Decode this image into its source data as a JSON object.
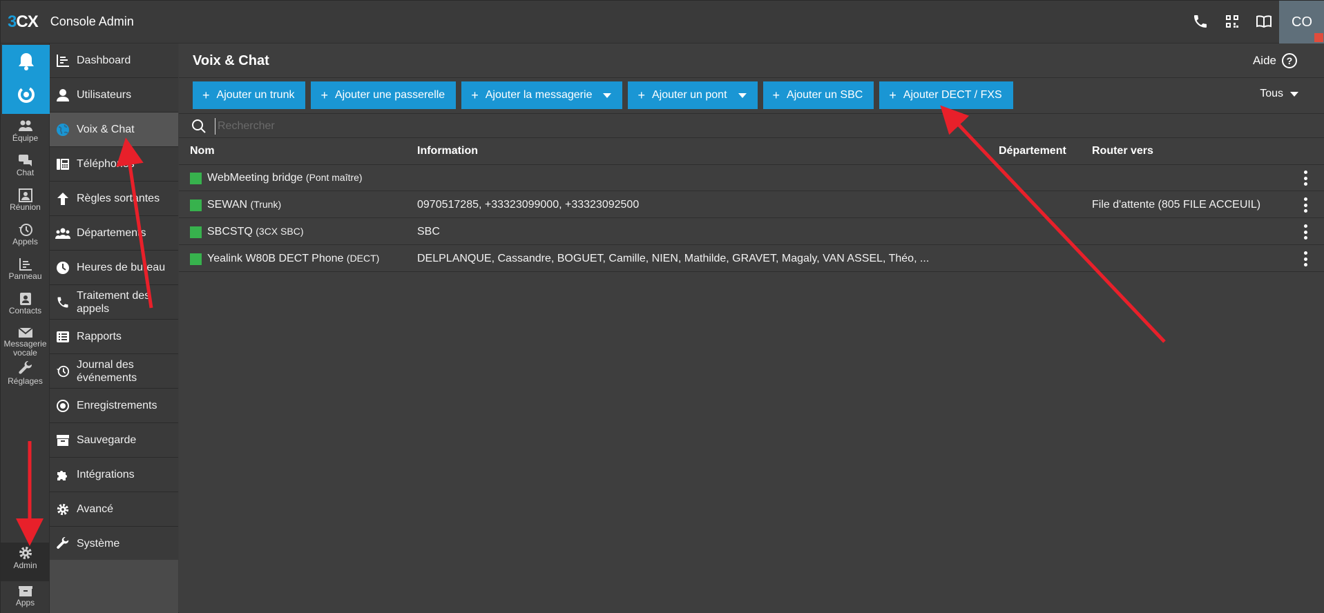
{
  "app": {
    "logo_prefix": "3",
    "logo_suffix": "CX",
    "title": "Console Admin",
    "avatar_initials": "CO"
  },
  "rail": {
    "items": [
      {
        "label": "Équipe",
        "icon": "team-icon"
      },
      {
        "label": "Chat",
        "icon": "chat-icon"
      },
      {
        "label": "Réunion",
        "icon": "meeting-icon"
      },
      {
        "label": "Appels",
        "icon": "history-icon"
      },
      {
        "label": "Panneau",
        "icon": "panel-icon"
      },
      {
        "label": "Contacts",
        "icon": "contacts-icon"
      },
      {
        "label": "Messagerie",
        "label2": "vocale",
        "icon": "voicemail-icon"
      },
      {
        "label": "Réglages",
        "icon": "wrench-icon"
      },
      {
        "label": "Admin",
        "icon": "gear-icon"
      },
      {
        "label": "Apps",
        "icon": "apps-icon"
      }
    ]
  },
  "submenu": {
    "items": [
      {
        "label": "Dashboard",
        "icon": "dashboard-icon"
      },
      {
        "label": "Utilisateurs",
        "icon": "user-icon"
      },
      {
        "label": "Voix & Chat",
        "icon": "globe-icon",
        "active": true
      },
      {
        "label": "Téléphones",
        "icon": "phone-device-icon"
      },
      {
        "label": "Règles sortantes",
        "icon": "arrow-up-icon"
      },
      {
        "label": "Départements",
        "icon": "departments-icon"
      },
      {
        "label": "Heures de bureau",
        "icon": "clock-icon"
      },
      {
        "label": "Traitement des",
        "label2": "appels",
        "icon": "phone-icon"
      },
      {
        "label": "Rapports",
        "icon": "report-icon"
      },
      {
        "label": "Journal des",
        "label2": "événements",
        "icon": "history-icon"
      },
      {
        "label": "Enregistrements",
        "icon": "record-icon"
      },
      {
        "label": "Sauvegarde",
        "icon": "archive-icon"
      },
      {
        "label": "Intégrations",
        "icon": "puzzle-icon"
      },
      {
        "label": "Avancé",
        "icon": "gear-icon"
      },
      {
        "label": "Système",
        "icon": "wrench-icon"
      }
    ]
  },
  "main": {
    "page_title": "Voix & Chat",
    "help_label": "Aide",
    "buttons": [
      {
        "label": "Ajouter un trunk",
        "dropdown": false
      },
      {
        "label": "Ajouter une passerelle",
        "dropdown": false
      },
      {
        "label": "Ajouter la messagerie",
        "dropdown": true
      },
      {
        "label": "Ajouter un pont",
        "dropdown": true
      },
      {
        "label": "Ajouter un SBC",
        "dropdown": false
      },
      {
        "label": "Ajouter DECT / FXS",
        "dropdown": false
      }
    ],
    "filter_label": "Tous",
    "search_placeholder": "Rechercher",
    "columns": {
      "name": "Nom",
      "info": "Information",
      "department": "Département",
      "route": "Router vers"
    },
    "rows": [
      {
        "name": "WebMeeting bridge",
        "type": "(Pont maître)",
        "info": "",
        "department": "",
        "route": "",
        "status_color": "#37b24d"
      },
      {
        "name": "SEWAN",
        "type": "(Trunk)",
        "info": "0970517285, +33323099000, +33323092500",
        "department": "",
        "route": "File d'attente (805 FILE ACCEUIL)",
        "status_color": "#37b24d"
      },
      {
        "name": "SBCSTQ",
        "type": "(3CX SBC)",
        "info": "SBC",
        "department": "",
        "route": "",
        "status_color": "#37b24d"
      },
      {
        "name": "Yealink W80B DECT Phone",
        "type": "(DECT)",
        "info": "DELPLANQUE, Cassandre, BOGUET, Camille, NIEN, Mathilde, GRAVET, Magaly, VAN ASSEL, Théo, ...",
        "department": "",
        "route": "",
        "status_color": "#37b24d"
      }
    ]
  },
  "colors": {
    "accent": "#1a96d4",
    "status_ok": "#37b24d",
    "annotation_arrow": "#e8202a"
  }
}
